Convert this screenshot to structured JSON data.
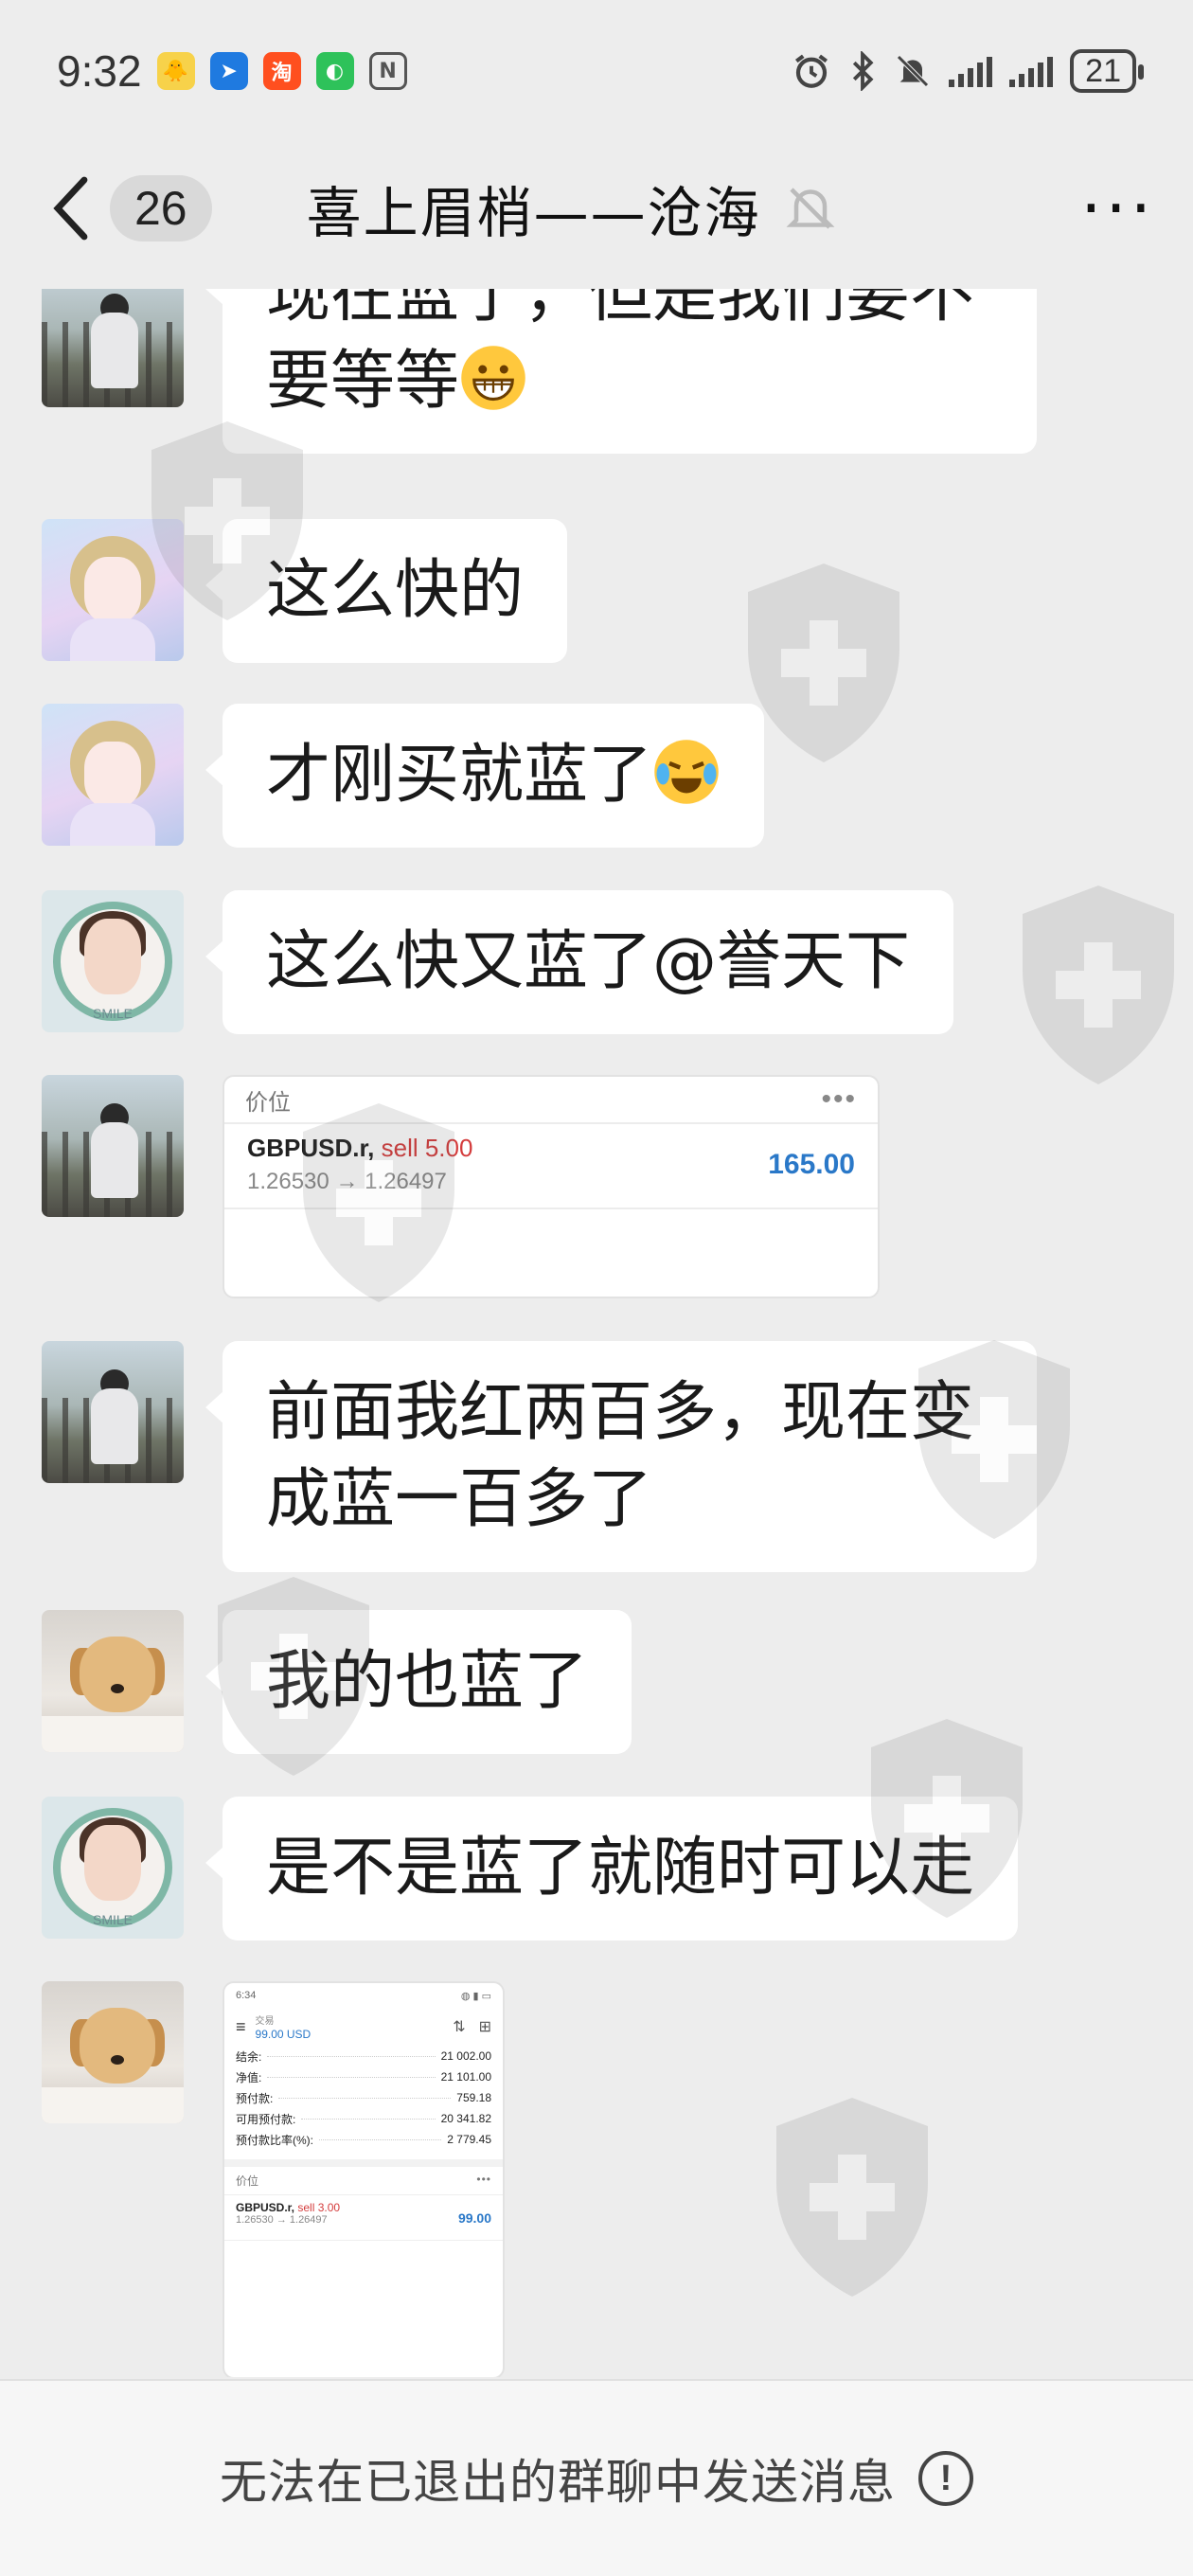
{
  "status_bar": {
    "time": "9:32",
    "apps": [
      {
        "icon": "chick-app-icon",
        "glyph": "🐥",
        "color": "#f7d24a"
      },
      {
        "icon": "arrow-app-icon",
        "glyph": "➤",
        "color": "#1f7ae0"
      },
      {
        "icon": "taobao-icon",
        "glyph": "淘",
        "color": "#ff4f1f"
      },
      {
        "icon": "wechat-icon",
        "glyph": "◐",
        "color": "#2ec25a"
      },
      {
        "icon": "nfc-icon",
        "glyph": "N",
        "color": "#555555"
      }
    ],
    "battery": "21"
  },
  "header": {
    "unread_count": "26",
    "title": "喜上眉梢——沧海"
  },
  "messages": [
    {
      "avatar": "man",
      "text": "现在蓝了，但是我们要不要等等"
    },
    {
      "avatar": "girl",
      "text": "这么快的"
    },
    {
      "avatar": "girl",
      "text": "才刚买就蓝了"
    },
    {
      "avatar": "frame",
      "text": "这么快又蓝了@誉天下"
    },
    {
      "avatar": "man",
      "card": "trade1"
    },
    {
      "avatar": "man",
      "text": "前面我红两百多，现在变成蓝一百多了"
    },
    {
      "avatar": "dog",
      "text": "我的也蓝了"
    },
    {
      "avatar": "frame",
      "text": "是不是蓝了就随时可以走"
    },
    {
      "avatar": "dog",
      "card": "trade2"
    }
  ],
  "avatar_frame_label": "SMILE",
  "trade1": {
    "section": "价位",
    "symbol": "GBPUSD.r,",
    "side": "sell 5.00",
    "price_from": "1.26530",
    "arrow": "→",
    "price_to": "1.26497",
    "profit": "165.00"
  },
  "trade2": {
    "status_time": "6:34",
    "status_icons": "◍ ▮ ▭",
    "header_small": "交易",
    "header_value": "99.00 USD",
    "rows": [
      {
        "k": "结余:",
        "v": "21 002.00"
      },
      {
        "k": "净值:",
        "v": "21 101.00"
      },
      {
        "k": "预付款:",
        "v": "759.18"
      },
      {
        "k": "可用预付款:",
        "v": "20 341.82"
      },
      {
        "k": "预付款比率(%):",
        "v": "2 779.45"
      }
    ],
    "section": "价位",
    "symbol": "GBPUSD.r,",
    "side": "sell 3.00",
    "price_from": "1.26530",
    "arrow": "→",
    "price_to": "1.26497",
    "profit": "99.00"
  },
  "footer": {
    "text": "无法在已退出的群聊中发送消息",
    "info_glyph": "!"
  },
  "colors": {
    "background": "#ededed",
    "bubble": "#ffffff",
    "profit_blue": "#2a78c8",
    "sell_red": "#d43c3c"
  }
}
